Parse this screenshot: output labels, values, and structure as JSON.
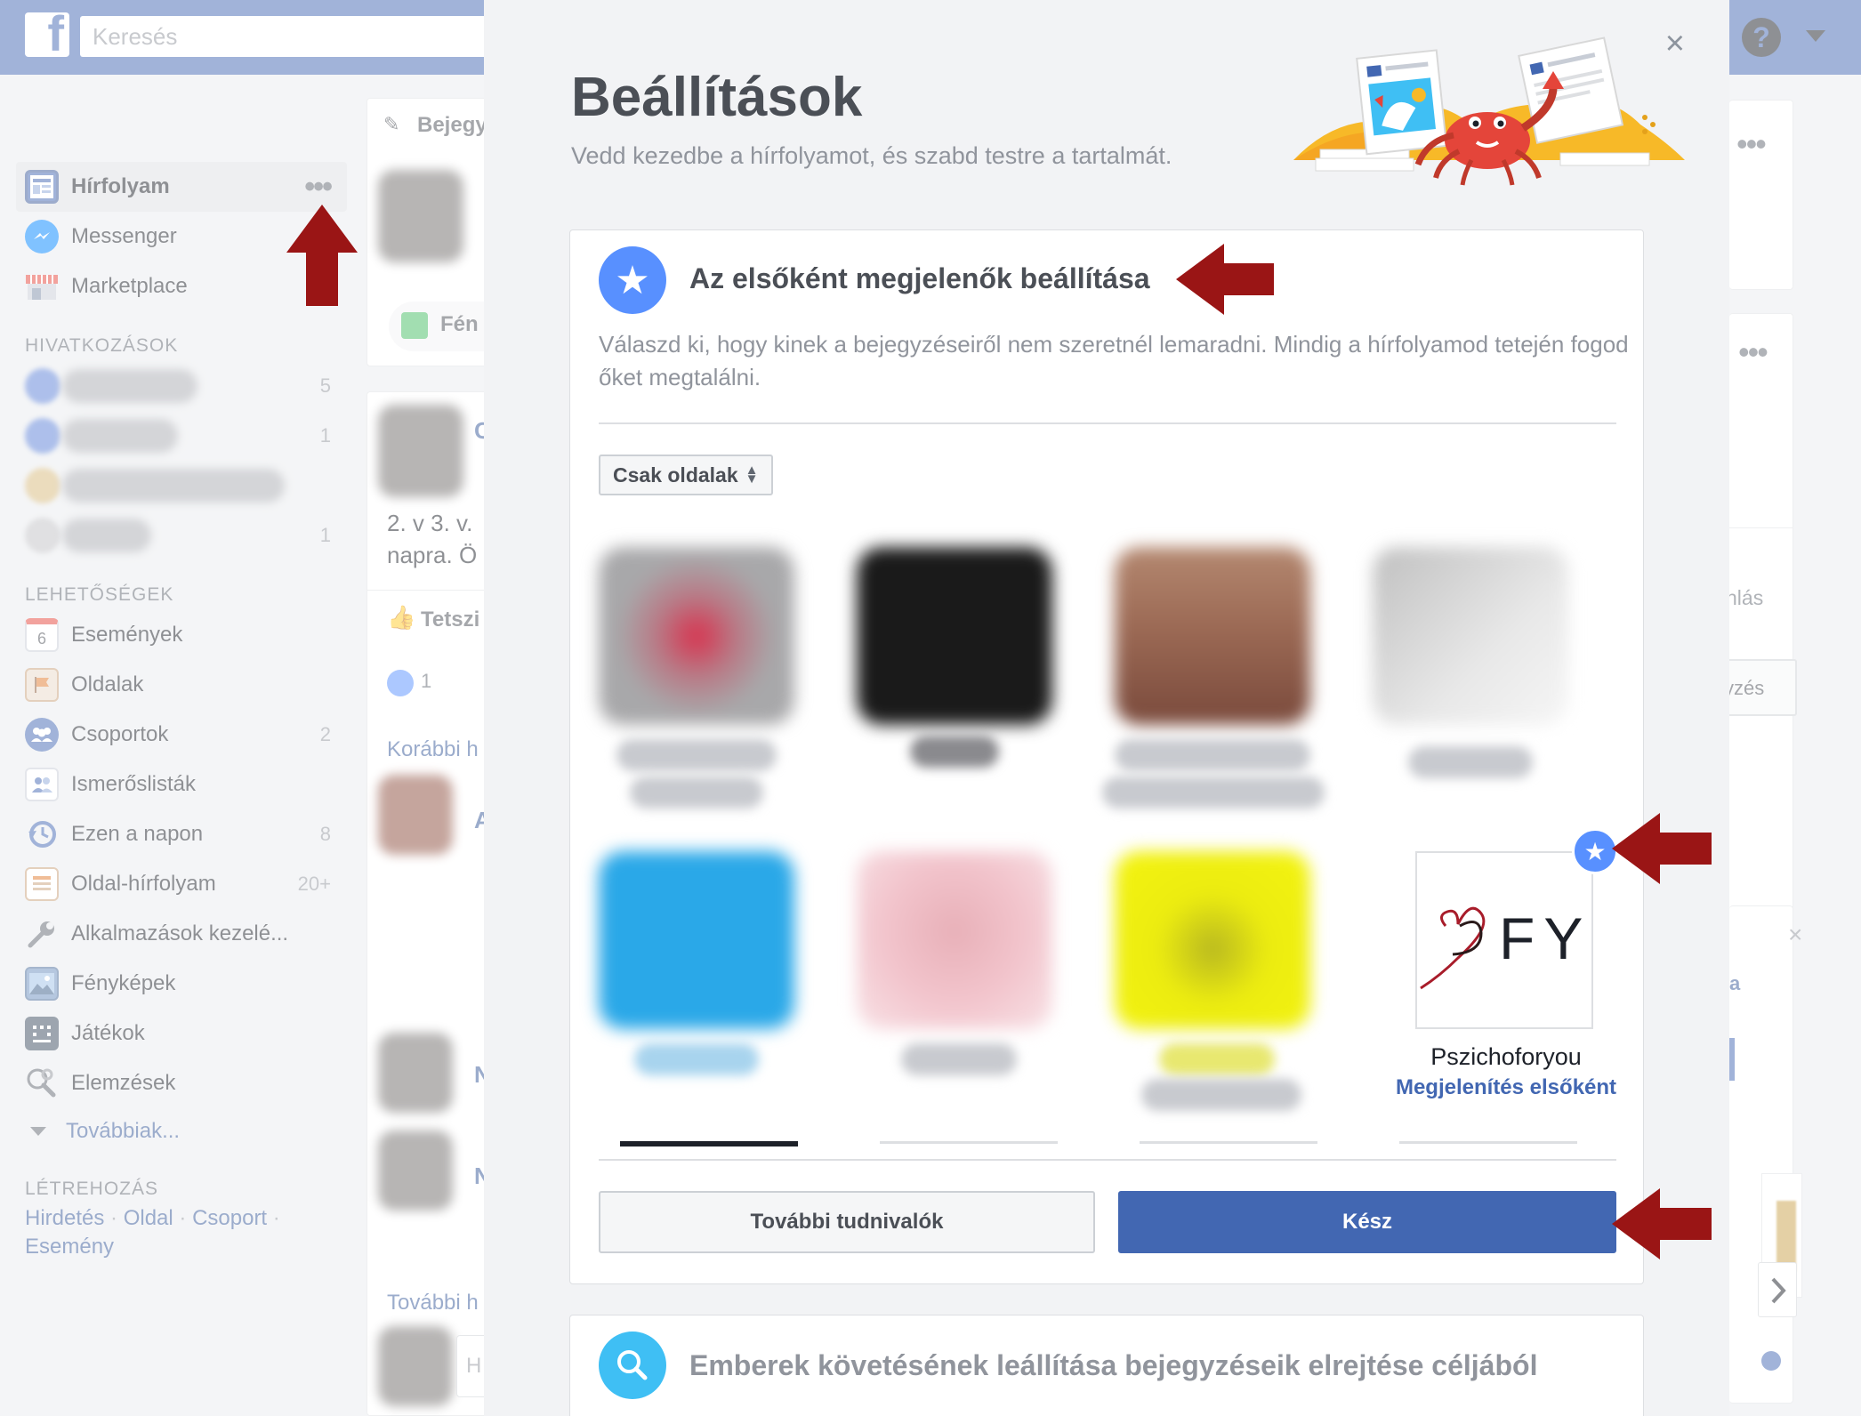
{
  "topbar": {
    "logo_letter": "f",
    "search_placeholder": "Keresés"
  },
  "sidebar": {
    "main_items": [
      {
        "label": "Hírfolyam",
        "icon": "news-feed-icon",
        "more": "•••"
      },
      {
        "label": "Messenger",
        "icon": "messenger-icon"
      },
      {
        "label": "Marketplace",
        "icon": "marketplace-icon"
      }
    ],
    "shortcuts_heading": "HIVATKOZÁSOK",
    "shortcut_counts": [
      "5",
      "1",
      "",
      "1"
    ],
    "explore_heading": "LEHETŐSÉGEK",
    "explore_items": [
      {
        "label": "Események",
        "icon": "calendar-icon",
        "icon_text": "6",
        "count": ""
      },
      {
        "label": "Oldalak",
        "icon": "flag-icon",
        "count": ""
      },
      {
        "label": "Csoportok",
        "icon": "groups-icon",
        "count": "2"
      },
      {
        "label": "Ismerőslisták",
        "icon": "friend-lists-icon",
        "count": ""
      },
      {
        "label": "Ezen a napon",
        "icon": "on-this-day-icon",
        "count": "8"
      },
      {
        "label": "Oldal-hírfolyam",
        "icon": "pages-feed-icon",
        "count": "20+"
      },
      {
        "label": "Alkalmazások kezelé...",
        "icon": "wrench-icon",
        "count": ""
      },
      {
        "label": "Fényképek",
        "icon": "photos-icon",
        "count": ""
      },
      {
        "label": "Játékok",
        "icon": "games-icon",
        "count": ""
      },
      {
        "label": "Elemzések",
        "icon": "insights-icon",
        "count": ""
      }
    ],
    "more_link": "Továbbiak...",
    "create_heading": "LÉTREHOZÁS",
    "create_links": {
      "ad": "Hirdetés",
      "page": "Oldal",
      "group": "Csoport",
      "event": "Esemény",
      "separator": " · "
    }
  },
  "feed": {
    "composer_tab": "Bejegy",
    "photo_button": "Fén",
    "post_text_line1": "2. v 3. v.",
    "post_text_line2": "napra. Ö",
    "post_author_initial": "C",
    "like_action": "Tetszi",
    "like_count": "1",
    "earlier_link": "Korábbi h",
    "comment_initial_a": "A",
    "comment_initial_n1": "N",
    "comment_initial_n2": "N",
    "more_link": "További h",
    "reply_initial": "H"
  },
  "rightcol": {
    "more": "•••",
    "suggest_label": "nlás",
    "button_label": "yzés",
    "close": "×",
    "snippet": "a"
  },
  "modal": {
    "close_label": "×",
    "title": "Beállítások",
    "subtitle": "Vedd kezedbe a hírfolyamot, és szabd testre a tartalmát.",
    "see_first": {
      "title": "Az elsőként megjelenők beállítása",
      "description": "Válaszd ki, hogy kinek a bejegyzéseiről nem szeretnél lemaradni. Mindig a hírfolyamod tetején fogod őket megtalálni.",
      "filter": "Csak oldalak",
      "pfy_logo_text": "FY",
      "pfy_logo_initial": "P",
      "pfy_name": "Pszichoforyou",
      "pfy_action": "Megjelenítés elsőként",
      "learn_more": "További tudnivalók",
      "done": "Kész"
    },
    "unfollow": {
      "title": "Emberek követésének leállítása bejegyzéseik elrejtése céljából"
    }
  },
  "colors": {
    "facebook_blue": "#4267b2",
    "star_blue": "#5890ff",
    "search_cyan": "#3fbff4",
    "arrow_red": "#9a1515",
    "thumb_colors": [
      "#c46a7a",
      "#1a1a1a",
      "#9c6a55",
      "#d8d8d8",
      "#2aa8e8",
      "#f2c4cc",
      "#ecec10"
    ]
  }
}
